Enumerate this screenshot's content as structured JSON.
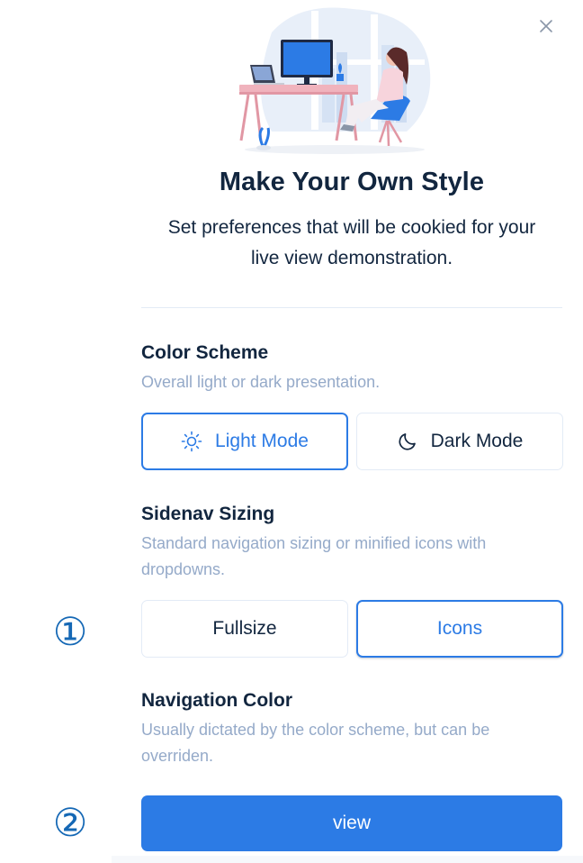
{
  "header": {
    "close_icon": "close-icon",
    "illustration": "desk-workspace-illustration"
  },
  "intro": {
    "title": "Make Your Own Style",
    "subtitle_line1": "Set preferences that will be cookied for your",
    "subtitle_line2": "live view demonstration."
  },
  "color_scheme": {
    "title": "Color Scheme",
    "description": "Overall light or dark presentation.",
    "options": [
      {
        "label": "Light Mode",
        "icon": "sun-icon",
        "selected": true
      },
      {
        "label": "Dark Mode",
        "icon": "moon-icon",
        "selected": false
      }
    ]
  },
  "sidenav": {
    "title": "Sidenav Sizing",
    "description_line1": "Standard navigation sizing or minified icons with",
    "description_line2": "dropdowns.",
    "options": [
      {
        "label": "Fullsize",
        "selected": false
      },
      {
        "label": "Icons",
        "selected": true
      }
    ]
  },
  "nav_color": {
    "title": "Navigation Color",
    "description_line1": "Usually dictated by the color scheme, but can be",
    "description_line2": "overriden.",
    "button_label": "view"
  },
  "markers": {
    "one": "①",
    "two": "②"
  },
  "colors": {
    "primary": "#2c7be5",
    "text": "#12263f",
    "muted": "#95aac9",
    "border": "#e3ebf6",
    "marker": "#1568b5"
  }
}
